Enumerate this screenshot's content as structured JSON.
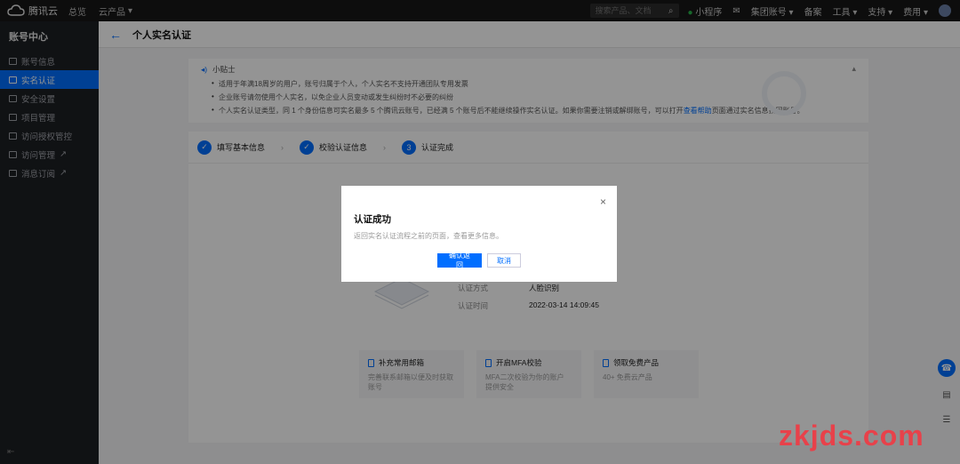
{
  "topbar": {
    "logo_text": "腾讯云",
    "nav": [
      "总览",
      "云产品"
    ],
    "search_placeholder": "搜索产品、文档",
    "right_items": [
      "小程序",
      "集团账号",
      "备案",
      "工具",
      "支持",
      "费用"
    ]
  },
  "sidebar": {
    "title": "账号中心",
    "items": [
      {
        "label": "账号信息",
        "active": false
      },
      {
        "label": "实名认证",
        "active": true
      },
      {
        "label": "安全设置",
        "active": false
      },
      {
        "label": "项目管理",
        "active": false
      },
      {
        "label": "访问授权管控",
        "active": false
      },
      {
        "label": "访问管理",
        "active": false
      },
      {
        "label": "消息订阅",
        "active": false
      }
    ]
  },
  "header": {
    "title": "个人实名认证"
  },
  "notice": {
    "title": "小贴士",
    "lines": [
      "适用于年满18周岁的用户，账号归属于个人，个人实名不支持开通团队专用发票",
      "企业账号请勿使用个人实名，以免企业人员变动或发生纠纷时不必要的纠纷",
      "个人实名认证类型，同 1 个身份信息可实名最多 5 个腾讯云账号，已经满 5 个账号后不能继续操作实名认证。如果你需要注销或解绑账号，可以打开"
    ],
    "link_text": "查看帮助",
    "line3_tail": "页面通过实名信息找回账号。"
  },
  "steps": [
    {
      "label": "填写基本信息",
      "state": "done"
    },
    {
      "label": "校验认证信息",
      "state": "done"
    },
    {
      "label": "认证完成",
      "state": "current",
      "number": "3"
    }
  ],
  "result": {
    "rows": [
      {
        "label": "认证方式",
        "value": "人脸识别"
      },
      {
        "label": "认证时间",
        "value": "2022-03-14 14:09:45"
      }
    ]
  },
  "promos": [
    {
      "title": "补充常用邮箱",
      "desc": [
        "完善联系邮箱以便及时获取",
        "账号"
      ]
    },
    {
      "title": "开启MFA校验",
      "desc": [
        "MFA二次校验为你的账户",
        "提供安全"
      ]
    },
    {
      "title": "领取免费产品",
      "desc": [
        "40+ 免费云产品"
      ]
    }
  ],
  "dialog": {
    "title": "认证成功",
    "desc": "返回实名认证流程之前的页面，查看更多信息。",
    "confirm_label": "确认返回",
    "cancel_label": "取消",
    "close_symbol": "×"
  },
  "watermark": "zkjds.com",
  "colors": {
    "accent": "#006eff",
    "sidebar_bg": "#1d1f24",
    "topbar_bg": "#181818",
    "watermark": "#e8414a"
  }
}
